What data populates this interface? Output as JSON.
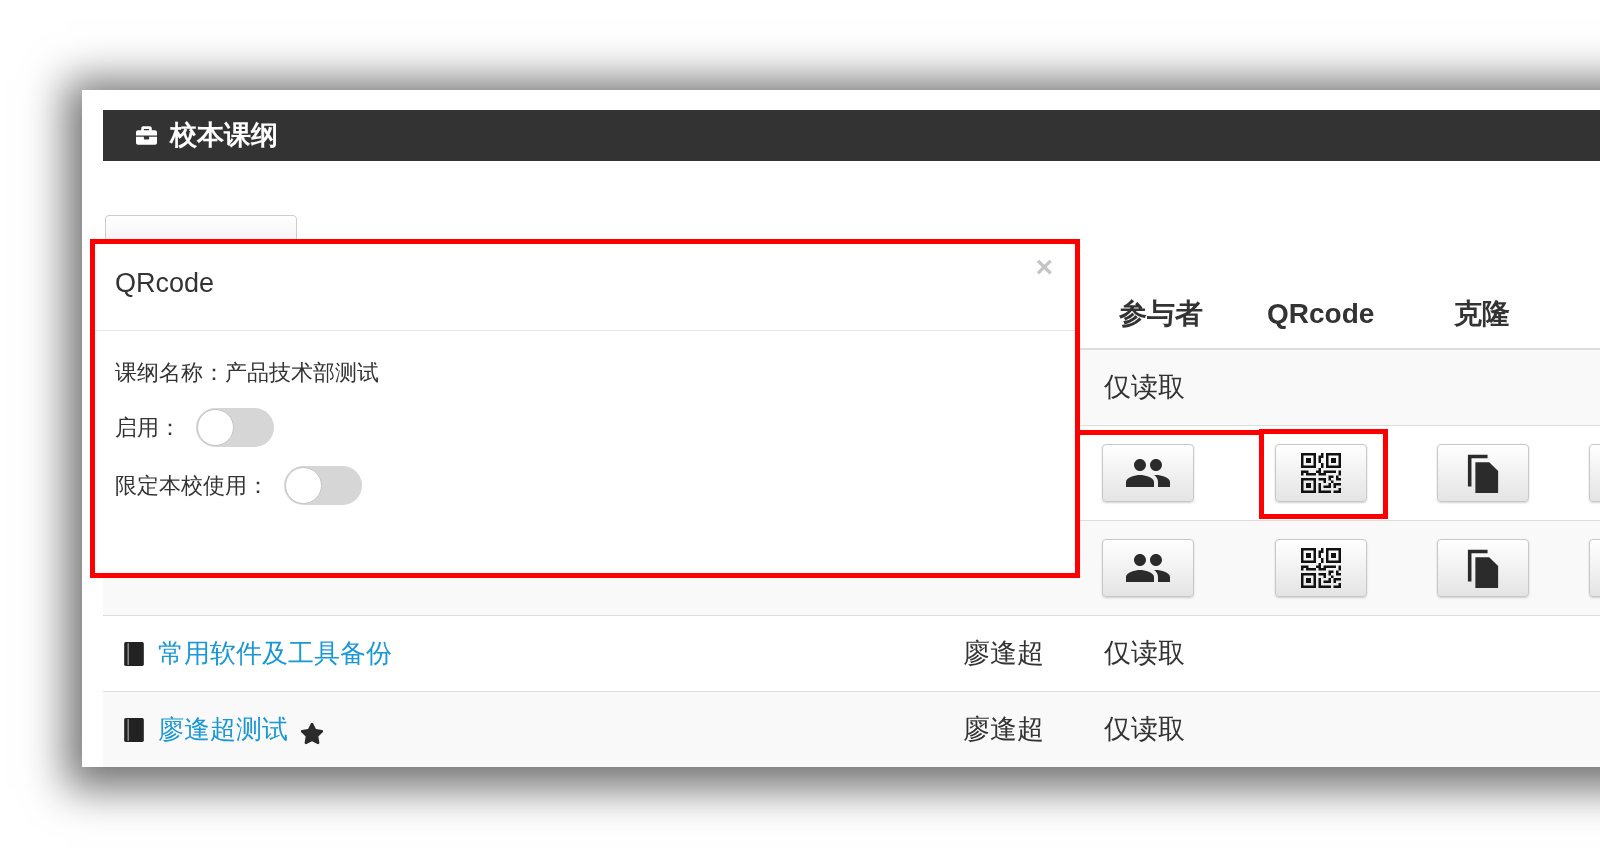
{
  "header": {
    "title": "校本课纲"
  },
  "table": {
    "columns": [
      "参与者",
      "QRcode",
      "克隆"
    ],
    "rows": [
      {
        "kind": "text",
        "access": "仅读取"
      },
      {
        "kind": "actions",
        "buttons": [
          {
            "kind": "participants",
            "highlighted": false
          },
          {
            "kind": "qrcode",
            "highlighted": true
          },
          {
            "kind": "clone",
            "highlighted": false
          },
          {
            "kind": "other",
            "highlighted": false
          }
        ]
      },
      {
        "kind": "actions",
        "buttons": [
          {
            "kind": "participants",
            "highlighted": false
          },
          {
            "kind": "qrcode",
            "highlighted": false
          },
          {
            "kind": "clone",
            "highlighted": false
          },
          {
            "kind": "other",
            "highlighted": false
          }
        ]
      },
      {
        "kind": "text",
        "title": "常用软件及工具备份",
        "starred": false,
        "owner": "廖逢超",
        "access": "仅读取"
      },
      {
        "kind": "text",
        "title": "廖逢超测试",
        "starred": true,
        "owner": "廖逢超",
        "access": "仅读取"
      }
    ]
  },
  "modal": {
    "title": "QRcode",
    "close": "×",
    "highlighted": true,
    "fields": [
      {
        "kind": "text",
        "text": "课纲名称：产品技术部测试"
      },
      {
        "kind": "toggle",
        "label": "启用：",
        "on": false
      },
      {
        "kind": "toggle",
        "label": "限定本校使用：",
        "on": false
      }
    ]
  }
}
